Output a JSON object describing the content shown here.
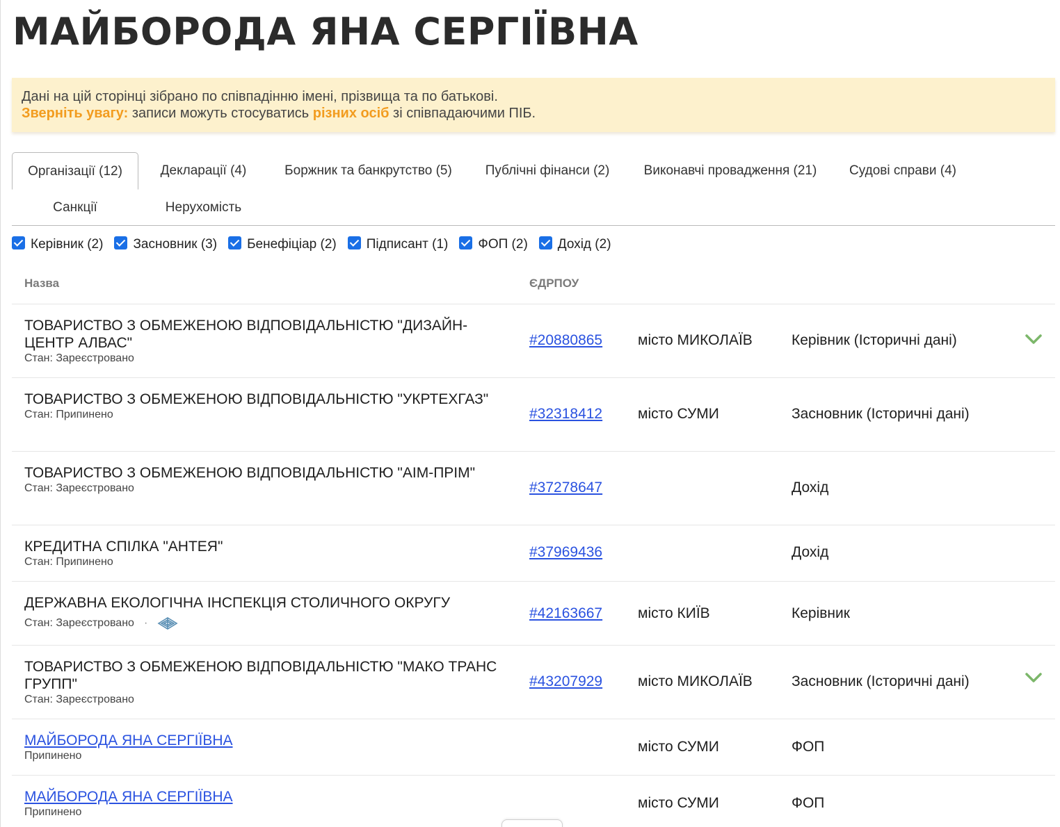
{
  "page_title": "МАЙБОРОДА ЯНА СЕРГІЇВНА",
  "notice": {
    "line1": "Дані на цій сторінці зібрано по співпадінню імені, прізвища та по батькові.",
    "attention": "Зверніть увагу:",
    "line2_a": " записи можуть стосуватись ",
    "different_persons": "різних осіб",
    "line2_b": " зі співпадаючими ПІБ."
  },
  "tabs": [
    {
      "label": "Організації (12)",
      "active": true
    },
    {
      "label": "Декларації (4)",
      "active": false
    },
    {
      "label": "Боржник та банкрутство (5)",
      "active": false
    },
    {
      "label": "Публічні фінанси (2)",
      "active": false
    },
    {
      "label": "Виконавчі провадження (21)",
      "active": false
    },
    {
      "label": "Судові справи (4)",
      "active": false
    },
    {
      "label": "Санкції",
      "active": false
    },
    {
      "label": "Нерухомість",
      "active": false
    }
  ],
  "filters": [
    {
      "label": "Керівник (2)",
      "checked": true
    },
    {
      "label": "Засновник (3)",
      "checked": true
    },
    {
      "label": "Бенефіціар (2)",
      "checked": true
    },
    {
      "label": "Підписант (1)",
      "checked": true
    },
    {
      "label": "ФОП (2)",
      "checked": true
    },
    {
      "label": "Дохід (2)",
      "checked": true
    }
  ],
  "table": {
    "col_name": "Назва",
    "col_code": "ЄДРПОУ",
    "rows": [
      {
        "name": "ТОВАРИСТВО З ОБМЕЖЕНОЮ ВІДПОВІДАЛЬНІСТЮ \"ДИЗАЙН-ЦЕНТР АЛВАС\"",
        "status": "Стан: Зареєстровано",
        "code": "#20880865",
        "city": "місто МИКОЛАЇВ",
        "role": "Керівник (Історичні дані)",
        "expand": true
      },
      {
        "name": "ТОВАРИСТВО З ОБМЕЖЕНОЮ ВІДПОВІДАЛЬНІСТЮ \"УКРТЕХГАЗ\"",
        "status": "Стан: Припинено",
        "code": "#32318412",
        "city": "місто СУМИ",
        "role": "Засновник (Історичні дані)",
        "expand": false
      },
      {
        "name": "ТОВАРИСТВО З ОБМЕЖЕНОЮ ВІДПОВІДАЛЬНІСТЮ \"АІМ-ПРІМ\"",
        "status": "Стан: Зареєстровано",
        "code": "#37278647",
        "city": "",
        "role": "Дохід",
        "expand": false
      },
      {
        "name": "КРЕДИТНА СПІЛКА \"АНТЕЯ\"",
        "status": "Стан: Припинено",
        "code": "#37969436",
        "city": "",
        "role": "Дохід",
        "expand": false
      },
      {
        "name": "ДЕРЖАВНА ЕКОЛОГІЧНА ІНСПЕКЦІЯ СТОЛИЧНОГО ОКРУГУ",
        "status": "Стан: Зареєстровано",
        "code": "#42163667",
        "city": "місто КИЇВ",
        "role": "Керівник",
        "expand": false
      },
      {
        "name": "ТОВАРИСТВО З ОБМЕЖЕНОЮ ВІДПОВІДАЛЬНІСТЮ \"МАКО ТРАНС ГРУПП\"",
        "status": "Стан: Зареєстровано",
        "code": "#43207929",
        "city": "місто МИКОЛАЇВ",
        "role": "Засновник (Історичні дані)",
        "expand": true
      },
      {
        "name": "МАЙБОРОДА ЯНА СЕРГІЇВНА",
        "status": "Припинено",
        "code": "",
        "city": "місто СУМИ",
        "role": "ФОП",
        "expand": false
      },
      {
        "name": "МАЙБОРОДА ЯНА СЕРГІЇВНА",
        "status": "Припинено",
        "code": "",
        "city": "місто СУМИ",
        "role": "ФОП",
        "expand": false
      }
    ]
  },
  "colors": {
    "accent_orange": "#f29c1f",
    "link_blue": "#2a52e0",
    "checkbox_blue": "#1a6fe6",
    "chevron_green": "#7cb76a",
    "notice_bg": "#fdf1cd"
  },
  "icons": {
    "expand": "chevron-down-icon",
    "government": "ministry-logo-icon",
    "checkbox": "checkbox-checked-icon"
  }
}
